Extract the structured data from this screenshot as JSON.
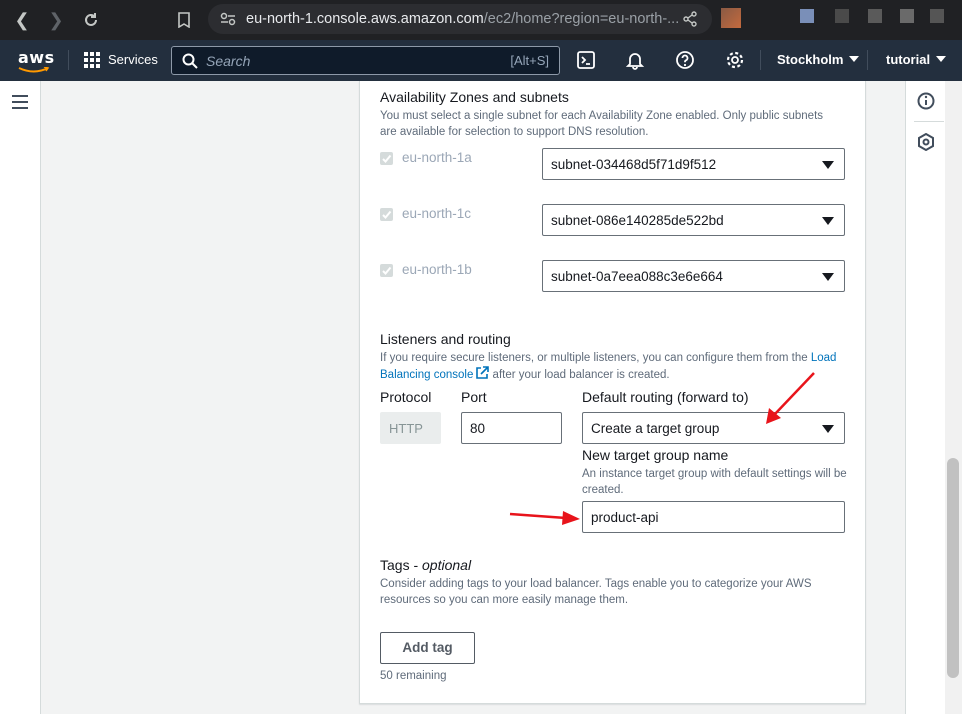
{
  "browser": {
    "url_host": "eu-north-1.console.aws.amazon.com",
    "url_path": "/ec2/home?region=eu-north-..."
  },
  "aws_header": {
    "logo": "aws",
    "services_label": "Services",
    "search_placeholder": "Search",
    "search_shortcut": "[Alt+S]",
    "region": "Stockholm",
    "account": "tutorial"
  },
  "availability": {
    "title": "Availability Zones and subnets",
    "description": "You must select a single subnet for each Availability Zone enabled. Only public subnets are available for selection to support DNS resolution.",
    "zones": [
      {
        "name": "eu-north-1a",
        "subnet": "subnet-034468d5f71d9f512"
      },
      {
        "name": "eu-north-1c",
        "subnet": "subnet-086e140285de522bd"
      },
      {
        "name": "eu-north-1b",
        "subnet": "subnet-0a7eea088c3e6e664"
      }
    ]
  },
  "listeners": {
    "title": "Listeners and routing",
    "description_before": "If you require secure listeners, or multiple listeners, you can configure them from the",
    "link_text": "Load Balancing console",
    "description_after": "after your load balancer is created.",
    "protocol_label": "Protocol",
    "protocol_value": "HTTP",
    "port_label": "Port",
    "port_value": "80",
    "routing_label": "Default routing (forward to)",
    "routing_value": "Create a target group",
    "tg_name_label": "New target group name",
    "tg_name_desc": "An instance target group with default settings will be created.",
    "tg_name_value": "product-api"
  },
  "tags": {
    "title": "Tags - ",
    "title_optional": "optional",
    "description": "Consider adding tags to your load balancer. Tags enable you to categorize your AWS resources so you can more easily manage them.",
    "add_button": "Add tag",
    "remaining": "50 remaining"
  },
  "colors": {
    "aws_header": "#232f3e",
    "link": "#0073bb",
    "annotation_arrow": "#e8141b"
  }
}
